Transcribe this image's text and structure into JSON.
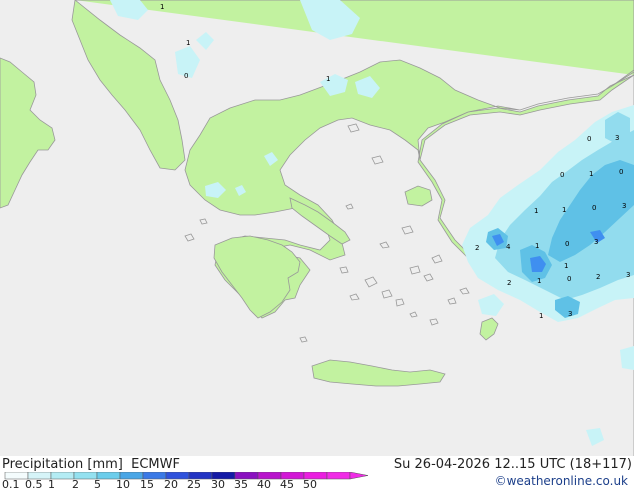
{
  "map": {
    "colors": {
      "sea": "#eeeeee",
      "land": "#c2f2a0",
      "coast": "#999999",
      "precip_light": "#c8f3f7",
      "precip_mid": "#92dcee",
      "precip_high": "#5fc1e6",
      "precip_peak": "#3f8ff0"
    },
    "cell_values": [
      "1",
      "1",
      "0",
      "1",
      "0",
      "3",
      "0",
      "1",
      "0",
      "1",
      "1",
      "0",
      "3",
      "2",
      "4",
      "1",
      "0",
      "3",
      "2",
      "1",
      "0",
      "2",
      "3",
      "1",
      "3",
      "1"
    ]
  },
  "footer": {
    "title": "Precipitation [mm]",
    "model": "ECMWF",
    "valid_time": "Su 26-04-2026 12..15 UTC (18+117)",
    "credit": "©weatheronline.co.uk"
  },
  "scale": {
    "labels": [
      "0.1",
      "0.5",
      "1",
      "2",
      "5",
      "10",
      "15",
      "20",
      "25",
      "30",
      "35",
      "40",
      "45",
      "50"
    ],
    "colors": [
      "#f4fcfd",
      "#d6f4f8",
      "#b4ecf4",
      "#94e1f0",
      "#6ccdeb",
      "#4aa6e6",
      "#3a79e6",
      "#2f52dc",
      "#2234c4",
      "#141aa6",
      "#8a10c0",
      "#b814cc",
      "#d218d6",
      "#ea1ee0",
      "#f02ce6"
    ]
  }
}
